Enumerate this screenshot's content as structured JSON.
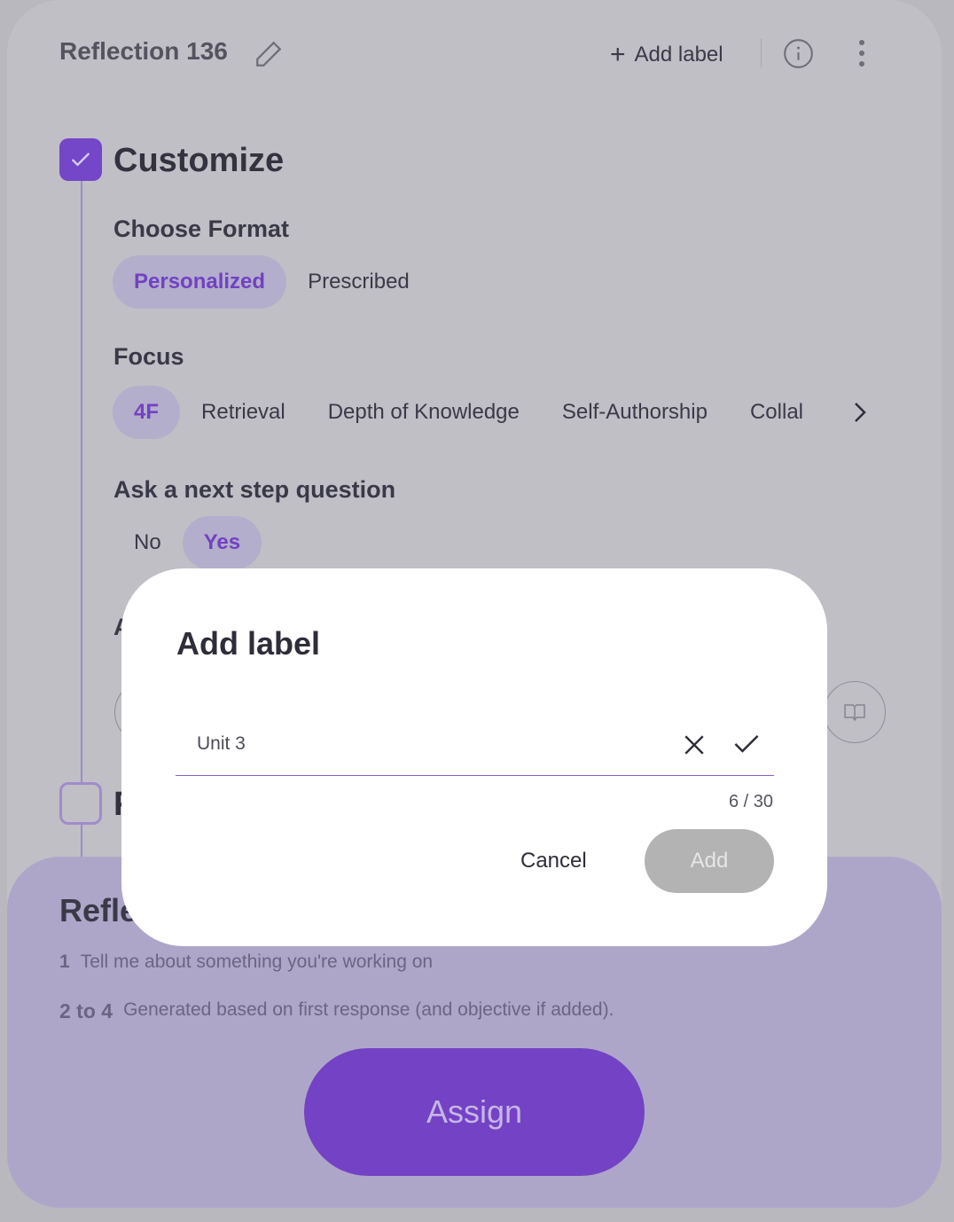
{
  "header": {
    "title": "Reflection 136",
    "add_label": "Add label"
  },
  "customize": {
    "title": "Customize",
    "format": {
      "label": "Choose Format",
      "options": [
        "Personalized",
        "Prescribed"
      ],
      "selected": "Personalized"
    },
    "focus": {
      "label": "Focus",
      "options": [
        "4F",
        "Retrieval",
        "Depth of Knowledge",
        "Self-Authorship",
        "Collal"
      ],
      "selected": "4F"
    },
    "next_step": {
      "label": "Ask a next step question",
      "options": [
        "No",
        "Yes"
      ],
      "selected": "Yes"
    },
    "partial_heading": "A",
    "next_step_partial": "F"
  },
  "summary": {
    "title": "Refle",
    "items": [
      {
        "num": "1",
        "text": "Tell me about something you're working on"
      },
      {
        "num": "2 to 4",
        "text": "Generated based on first response (and objective if added)."
      }
    ],
    "assign": "Assign"
  },
  "modal": {
    "title": "Add label",
    "input_value": "Unit 3",
    "counter": "6 / 30",
    "cancel": "Cancel",
    "add": "Add"
  },
  "colors": {
    "accent": "#7442c4"
  }
}
